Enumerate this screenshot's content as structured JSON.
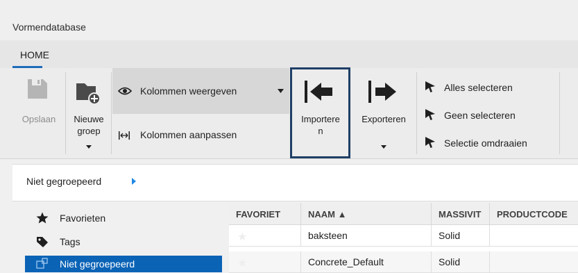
{
  "window": {
    "title": "Vormendatabase"
  },
  "tabs": [
    {
      "label": "HOME",
      "active": true
    }
  ],
  "ribbon": {
    "save_label": "Opslaan",
    "new_group_label_line1": "Nieuwe",
    "new_group_label_line2": "groep",
    "show_columns_label": "Kolommen weergeven",
    "adjust_columns_label": "Kolommen aanpassen",
    "import_label_line1": "Importere",
    "import_label_line2": "n",
    "export_label": "Exporteren",
    "select_all_label": "Alles selecteren",
    "select_none_label": "Geen selecteren",
    "invert_selection_label": "Selectie omdraaien"
  },
  "breadcrumb": {
    "label": "Niet gegroepeerd"
  },
  "sidebar": {
    "items": [
      {
        "label": "Favorieten",
        "icon": "star-icon"
      },
      {
        "label": "Tags",
        "icon": "tag-icon"
      },
      {
        "label": "Niet gegroepeerd",
        "icon": "ungrouped-icon",
        "selected": true
      }
    ]
  },
  "table": {
    "columns": [
      "FAVORIET",
      "NAAM ▲",
      "MASSIVIT",
      "PRODUCTCODE"
    ],
    "rows": [
      {
        "favoriet": "★",
        "naam": "baksteen",
        "massiviteit": "Solid",
        "productcode": ""
      },
      {
        "favoriet": "★",
        "naam": "Concrete_Default",
        "massiviteit": "Solid",
        "productcode": ""
      }
    ]
  },
  "colors": {
    "accent": "#0b63b6",
    "highlight_border": "#1f3f66",
    "selected_row": "#0b63b6"
  }
}
